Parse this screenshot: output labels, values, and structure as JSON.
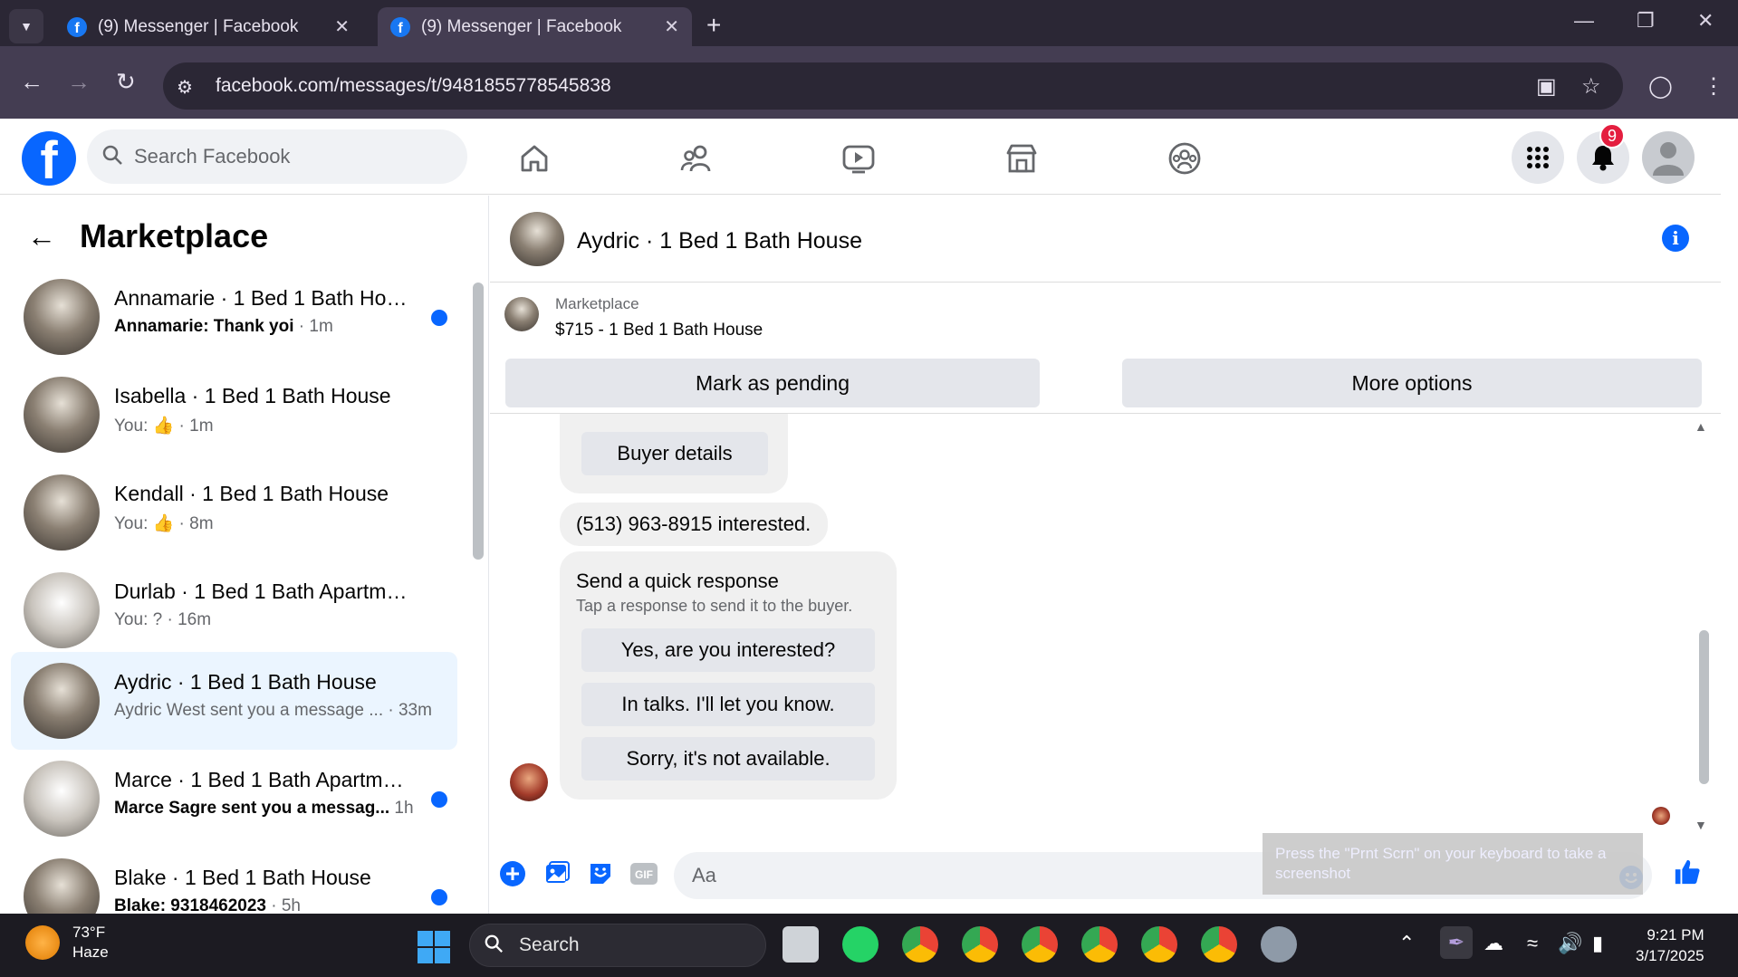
{
  "browser": {
    "tabs": [
      {
        "title": "(9) Messenger | Facebook",
        "active": false
      },
      {
        "title": "(9) Messenger | Facebook",
        "active": true
      }
    ],
    "url": "facebook.com/messages/t/9481855778545838"
  },
  "header": {
    "search_placeholder": "Search Facebook",
    "notification_count": "9"
  },
  "sidebar": {
    "title": "Marketplace",
    "conversations": [
      {
        "title": "Annamarie · 1 Bed 1 Bath House",
        "who": "Annamarie: Thank yoi",
        "time": " · 1m",
        "unread": true
      },
      {
        "title": "Isabella · 1 Bed 1 Bath House",
        "who": "You: 👍",
        "time": " · 1m",
        "unread": false
      },
      {
        "title": "Kendall · 1 Bed 1 Bath House",
        "who": "You: 👍",
        "time": " · 8m",
        "unread": false
      },
      {
        "title": "Durlab · 1 Bed 1 Bath Apartment...",
        "who": "You: ?",
        "time": " · 16m",
        "unread": false
      },
      {
        "title": "Aydric · 1 Bed 1 Bath House",
        "who": "Aydric West sent you a message ...",
        "time": " · 33m",
        "unread": false
      },
      {
        "title": "Marce · 1 Bed 1 Bath Apartmen...",
        "who": "Marce Sagre sent you a messag...",
        "time": "  1h",
        "unread": true
      },
      {
        "title": "Blake · 1 Bed 1 Bath House",
        "who": "Blake: 9318462023",
        "time": " · 5h",
        "unread": true
      }
    ]
  },
  "chat": {
    "name": "Aydric · 1 Bed 1 Bath House",
    "listing_category": "Marketplace",
    "listing_title": "$715 - 1 Bed 1 Bath House",
    "mark_pending": "Mark as pending",
    "more_options": "More options",
    "buyer_details": "Buyer details",
    "interested_msg": "(513) 963-8915 interested.",
    "quick_title": "Send a quick response",
    "quick_sub": "Tap a response to send it to the buyer.",
    "quick_responses": [
      "Yes, are you interested?",
      "In talks. I'll let you know.",
      "Sorry, it's not available."
    ],
    "input_placeholder": "Aa",
    "tooltip": "Press the \"Prnt Scrn\" on your keyboard to take a screenshot"
  },
  "taskbar": {
    "temp": "73°F",
    "weather": "Haze",
    "search": "Search",
    "time": "9:21 PM",
    "date": "3/17/2025"
  }
}
